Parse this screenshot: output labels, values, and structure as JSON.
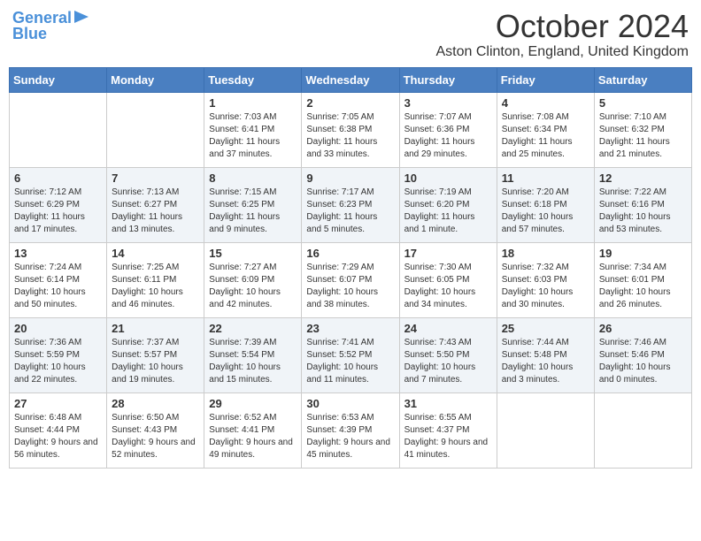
{
  "logo": {
    "line1": "General",
    "line2": "Blue"
  },
  "title": "October 2024",
  "location": "Aston Clinton, England, United Kingdom",
  "days_of_week": [
    "Sunday",
    "Monday",
    "Tuesday",
    "Wednesday",
    "Thursday",
    "Friday",
    "Saturday"
  ],
  "weeks": [
    [
      {
        "day": "",
        "info": ""
      },
      {
        "day": "",
        "info": ""
      },
      {
        "day": "1",
        "info": "Sunrise: 7:03 AM\nSunset: 6:41 PM\nDaylight: 11 hours and 37 minutes."
      },
      {
        "day": "2",
        "info": "Sunrise: 7:05 AM\nSunset: 6:38 PM\nDaylight: 11 hours and 33 minutes."
      },
      {
        "day": "3",
        "info": "Sunrise: 7:07 AM\nSunset: 6:36 PM\nDaylight: 11 hours and 29 minutes."
      },
      {
        "day": "4",
        "info": "Sunrise: 7:08 AM\nSunset: 6:34 PM\nDaylight: 11 hours and 25 minutes."
      },
      {
        "day": "5",
        "info": "Sunrise: 7:10 AM\nSunset: 6:32 PM\nDaylight: 11 hours and 21 minutes."
      }
    ],
    [
      {
        "day": "6",
        "info": "Sunrise: 7:12 AM\nSunset: 6:29 PM\nDaylight: 11 hours and 17 minutes."
      },
      {
        "day": "7",
        "info": "Sunrise: 7:13 AM\nSunset: 6:27 PM\nDaylight: 11 hours and 13 minutes."
      },
      {
        "day": "8",
        "info": "Sunrise: 7:15 AM\nSunset: 6:25 PM\nDaylight: 11 hours and 9 minutes."
      },
      {
        "day": "9",
        "info": "Sunrise: 7:17 AM\nSunset: 6:23 PM\nDaylight: 11 hours and 5 minutes."
      },
      {
        "day": "10",
        "info": "Sunrise: 7:19 AM\nSunset: 6:20 PM\nDaylight: 11 hours and 1 minute."
      },
      {
        "day": "11",
        "info": "Sunrise: 7:20 AM\nSunset: 6:18 PM\nDaylight: 10 hours and 57 minutes."
      },
      {
        "day": "12",
        "info": "Sunrise: 7:22 AM\nSunset: 6:16 PM\nDaylight: 10 hours and 53 minutes."
      }
    ],
    [
      {
        "day": "13",
        "info": "Sunrise: 7:24 AM\nSunset: 6:14 PM\nDaylight: 10 hours and 50 minutes."
      },
      {
        "day": "14",
        "info": "Sunrise: 7:25 AM\nSunset: 6:11 PM\nDaylight: 10 hours and 46 minutes."
      },
      {
        "day": "15",
        "info": "Sunrise: 7:27 AM\nSunset: 6:09 PM\nDaylight: 10 hours and 42 minutes."
      },
      {
        "day": "16",
        "info": "Sunrise: 7:29 AM\nSunset: 6:07 PM\nDaylight: 10 hours and 38 minutes."
      },
      {
        "day": "17",
        "info": "Sunrise: 7:30 AM\nSunset: 6:05 PM\nDaylight: 10 hours and 34 minutes."
      },
      {
        "day": "18",
        "info": "Sunrise: 7:32 AM\nSunset: 6:03 PM\nDaylight: 10 hours and 30 minutes."
      },
      {
        "day": "19",
        "info": "Sunrise: 7:34 AM\nSunset: 6:01 PM\nDaylight: 10 hours and 26 minutes."
      }
    ],
    [
      {
        "day": "20",
        "info": "Sunrise: 7:36 AM\nSunset: 5:59 PM\nDaylight: 10 hours and 22 minutes."
      },
      {
        "day": "21",
        "info": "Sunrise: 7:37 AM\nSunset: 5:57 PM\nDaylight: 10 hours and 19 minutes."
      },
      {
        "day": "22",
        "info": "Sunrise: 7:39 AM\nSunset: 5:54 PM\nDaylight: 10 hours and 15 minutes."
      },
      {
        "day": "23",
        "info": "Sunrise: 7:41 AM\nSunset: 5:52 PM\nDaylight: 10 hours and 11 minutes."
      },
      {
        "day": "24",
        "info": "Sunrise: 7:43 AM\nSunset: 5:50 PM\nDaylight: 10 hours and 7 minutes."
      },
      {
        "day": "25",
        "info": "Sunrise: 7:44 AM\nSunset: 5:48 PM\nDaylight: 10 hours and 3 minutes."
      },
      {
        "day": "26",
        "info": "Sunrise: 7:46 AM\nSunset: 5:46 PM\nDaylight: 10 hours and 0 minutes."
      }
    ],
    [
      {
        "day": "27",
        "info": "Sunrise: 6:48 AM\nSunset: 4:44 PM\nDaylight: 9 hours and 56 minutes."
      },
      {
        "day": "28",
        "info": "Sunrise: 6:50 AM\nSunset: 4:43 PM\nDaylight: 9 hours and 52 minutes."
      },
      {
        "day": "29",
        "info": "Sunrise: 6:52 AM\nSunset: 4:41 PM\nDaylight: 9 hours and 49 minutes."
      },
      {
        "day": "30",
        "info": "Sunrise: 6:53 AM\nSunset: 4:39 PM\nDaylight: 9 hours and 45 minutes."
      },
      {
        "day": "31",
        "info": "Sunrise: 6:55 AM\nSunset: 4:37 PM\nDaylight: 9 hours and 41 minutes."
      },
      {
        "day": "",
        "info": ""
      },
      {
        "day": "",
        "info": ""
      }
    ]
  ]
}
